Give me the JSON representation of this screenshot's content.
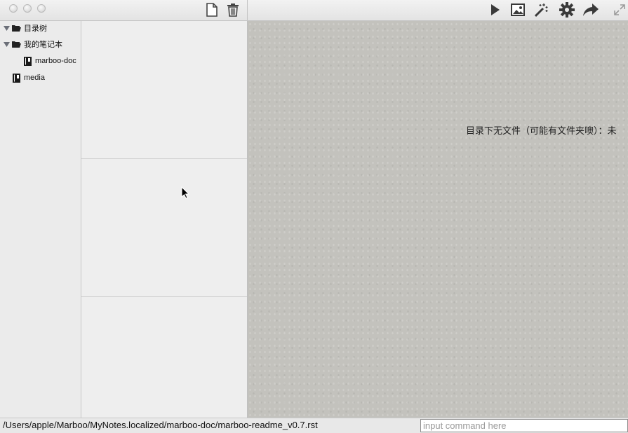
{
  "toolbar": {
    "left_icons": [
      "new-file-icon",
      "trash-icon"
    ],
    "right_icons": [
      "play-icon",
      "image-icon",
      "magic-wand-icon",
      "gear-icon",
      "share-arrow-icon",
      "fullscreen-icon"
    ]
  },
  "tree": {
    "items": [
      {
        "label": "目录树",
        "icon": "folder-open-icon",
        "expanded": true
      },
      {
        "label": "我的笔记本",
        "icon": "folder-open-icon",
        "expanded": true
      },
      {
        "label": "marboo-doc",
        "icon": "notebook-icon"
      },
      {
        "label": "media",
        "icon": "notebook-icon"
      }
    ]
  },
  "preview": {
    "message": "目录下无文件（可能有文件夹噢）：未"
  },
  "status": {
    "path": "/Users/apple/Marboo/MyNotes.localized/marboo-doc/marboo-readme_v0.7.rst",
    "command_placeholder": "input command here",
    "command_value": ""
  }
}
